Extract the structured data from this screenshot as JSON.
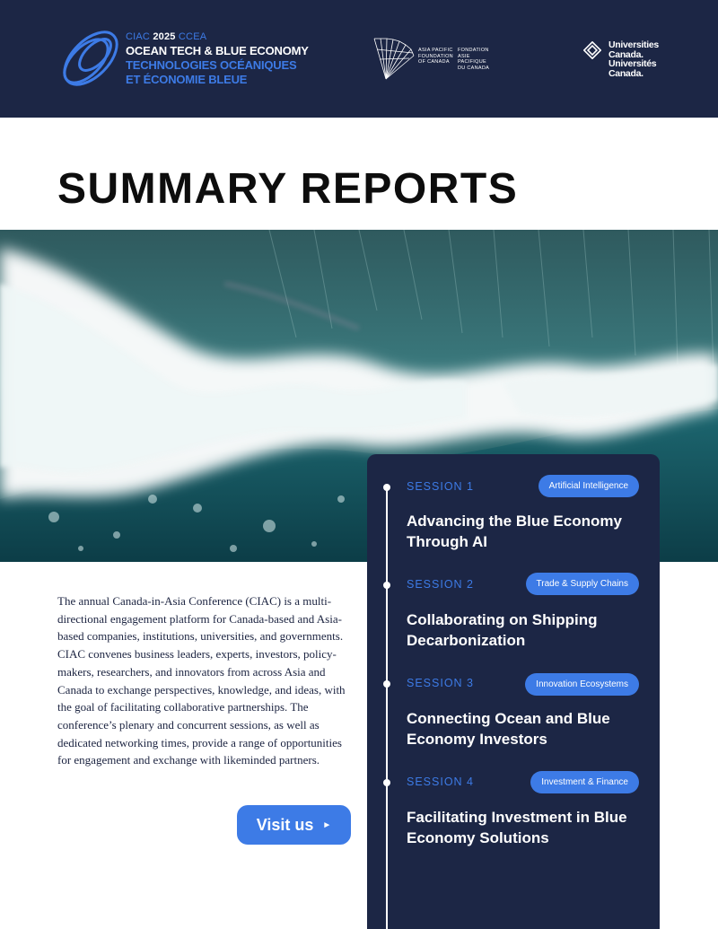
{
  "header": {
    "logo": {
      "prefix": "CIAC",
      "year": "2025",
      "suffix": "CCEA",
      "line2": "OCEAN TECH & BLUE ECONOMY",
      "line3": "TECHNOLOGIES OCÉANIQUES",
      "line4": "ET ÉCONOMIE BLEUE"
    },
    "apf": {
      "en": [
        "ASIA PACIFIC",
        "FOUNDATION",
        "OF CANADA"
      ],
      "fr": [
        "FONDATION",
        "ASIE PACIFIQUE",
        "DU CANADA"
      ],
      "icon": "apf-fan-icon"
    },
    "uc": {
      "lines": [
        "Universities",
        "Canada.",
        "Universités",
        "Canada."
      ],
      "icon": "uc-diamond-icon"
    }
  },
  "title": "SUMMARY REPORTS",
  "hero": {
    "icon": "ocean-wave-image"
  },
  "description": "The annual Canada-in-Asia Conference (CIAC) is a multi-directional engagement platform for Canada-based and Asia-based companies, institutions, universities, and governments. CIAC convenes business leaders, experts, investors, policy-makers, researchers, and innovators from across Asia and Canada to exchange perspectives, knowledge, and ideas, with the goal of facilitating collaborative partnerships. The conference’s plenary and concurrent sessions, as well as dedicated networking times, provide a range of opportunities for engagement and exchange with likeminded partners.",
  "visit": {
    "label": "Visit us",
    "icon": "play-arrow-icon"
  },
  "sessions": [
    {
      "label": "SESSION 1",
      "tag": "Artificial Intelligence",
      "title": "Advancing the Blue Economy Through AI"
    },
    {
      "label": "SESSION 2",
      "tag": "Trade & Supply Chains",
      "title": "Collaborating on Shipping Decarbonization"
    },
    {
      "label": "SESSION 3",
      "tag": "Innovation Ecosystems",
      "title": "Connecting Ocean and Blue Economy Investors"
    },
    {
      "label": "SESSION 4",
      "tag": "Investment & Finance",
      "title": "Facilitating Investment in Blue Economy Solutions"
    }
  ],
  "colors": {
    "navy": "#1c2645",
    "accent": "#3d7be6",
    "white": "#ffffff"
  }
}
